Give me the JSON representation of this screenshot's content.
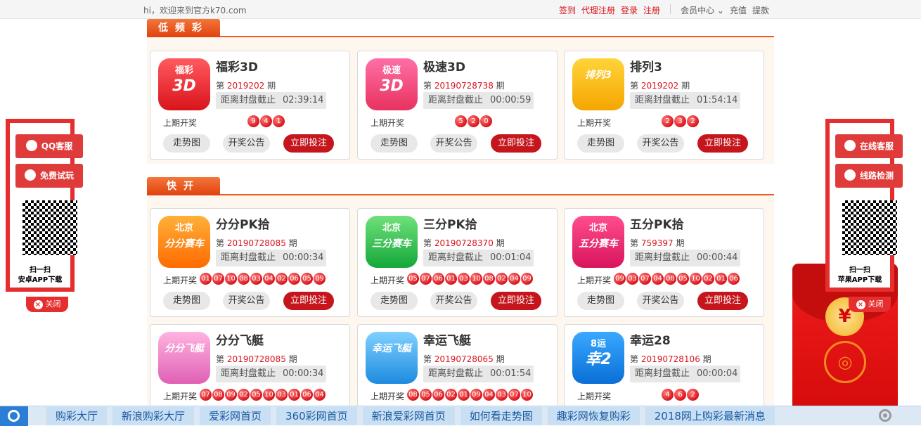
{
  "topbar": {
    "greeting": "hi，欢迎来到官方k70.com",
    "links": [
      "签到",
      "代理注册",
      "登录",
      "注册"
    ],
    "member_center": "会员中心",
    "recharge": "充值",
    "withdraw": "提款"
  },
  "sections": [
    {
      "title": "低频彩"
    },
    {
      "title": "快开"
    }
  ],
  "common": {
    "period_prefix": "第",
    "period_suffix": "期",
    "countdown_label": "距离封盘截止",
    "last_draw_label": "上期开奖",
    "trend_btn": "走势图",
    "notice_btn": "开奖公告",
    "bet_btn": "立即投注"
  },
  "games": [
    {
      "name": "福彩3D",
      "logo_top": "福彩",
      "logo_main": "3D",
      "period": "2019202",
      "countdown": "02:39:14",
      "balls": [
        "9",
        "4",
        "1"
      ]
    },
    {
      "name": "极速3D",
      "logo_top": "极速",
      "logo_main": "3D",
      "period": "20190728738",
      "countdown": "00:00:59",
      "balls": [
        "5",
        "2",
        "0"
      ]
    },
    {
      "name": "排列3",
      "logo_top": "",
      "logo_main": "排列3",
      "period": "2019202",
      "countdown": "01:54:14",
      "balls": [
        "2",
        "3",
        "2"
      ]
    },
    {
      "name": "分分PK拾",
      "logo_top": "北京",
      "logo_main": "分分赛车",
      "period": "20190728085",
      "countdown": "00:00:34",
      "balls": [
        "01",
        "07",
        "10",
        "08",
        "03",
        "04",
        "02",
        "06",
        "05",
        "09"
      ]
    },
    {
      "name": "三分PK拾",
      "logo_top": "北京",
      "logo_main": "三分赛车",
      "period": "20190728370",
      "countdown": "00:01:04",
      "balls": [
        "05",
        "07",
        "06",
        "01",
        "03",
        "10",
        "08",
        "02",
        "04",
        "09"
      ]
    },
    {
      "name": "五分PK拾",
      "logo_top": "北京",
      "logo_main": "五分赛车",
      "period": "759397",
      "countdown": "00:00:44",
      "balls": [
        "09",
        "03",
        "07",
        "04",
        "08",
        "05",
        "10",
        "02",
        "01",
        "06"
      ]
    },
    {
      "name": "分分飞艇",
      "logo_top": "",
      "logo_main": "分分飞艇",
      "period": "20190728085",
      "countdown": "00:00:34",
      "balls": [
        "07",
        "08",
        "09",
        "02",
        "05",
        "10",
        "03",
        "01",
        "06",
        "04"
      ]
    },
    {
      "name": "幸运飞艇",
      "logo_top": "",
      "logo_main": "幸运飞艇",
      "period": "20190728065",
      "countdown": "00:01:54",
      "balls": [
        "08",
        "05",
        "06",
        "02",
        "01",
        "09",
        "04",
        "03",
        "07",
        "10"
      ]
    },
    {
      "name": "幸运28",
      "logo_top": "8运",
      "logo_main": "幸2",
      "period": "20190728106",
      "countdown": "00:00:04",
      "balls": [
        "4",
        "6",
        "2"
      ]
    }
  ],
  "left_panel": {
    "btn1": "QQ客服",
    "btn2": "免费试玩",
    "scan": "扫一扫",
    "download": "安卓APP下载",
    "close": "关闭"
  },
  "right_panel": {
    "btn1": "在线客服",
    "btn2": "线路检测",
    "scan": "扫一扫",
    "download": "苹果APP下载",
    "close": "关闭"
  },
  "redpack": {
    "coin": "¥"
  },
  "bottom_links": [
    "购彩大厅",
    "新浪购彩大厅",
    "爱彩网首页",
    "360彩网首页",
    "新浪爱彩网首页",
    "如何看走势图",
    "趣彩网恢复购彩",
    "2018网上购彩最新消息"
  ]
}
